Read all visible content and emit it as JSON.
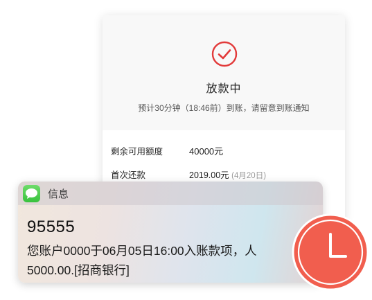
{
  "status_card": {
    "title": "放款中",
    "description": "预计30分钟（18:46前）到账，请留意到账通知",
    "icon": "check-circle-icon",
    "accent_color": "#e23a3a",
    "rows": [
      {
        "label": "剩余可用额度",
        "value": "40000元"
      },
      {
        "label": "首次还款",
        "value": "2019.00元",
        "note": "(4月20日)"
      }
    ]
  },
  "notification": {
    "app_name": "信息",
    "app_icon": "messages-app-icon",
    "sender": "95555",
    "message_line1": "您账户0000于06月05日16:00入账款项，人",
    "message_line2": "5000.00.[招商银行]"
  },
  "badge": {
    "icon": "clock-icon",
    "color": "#f15e4e"
  }
}
